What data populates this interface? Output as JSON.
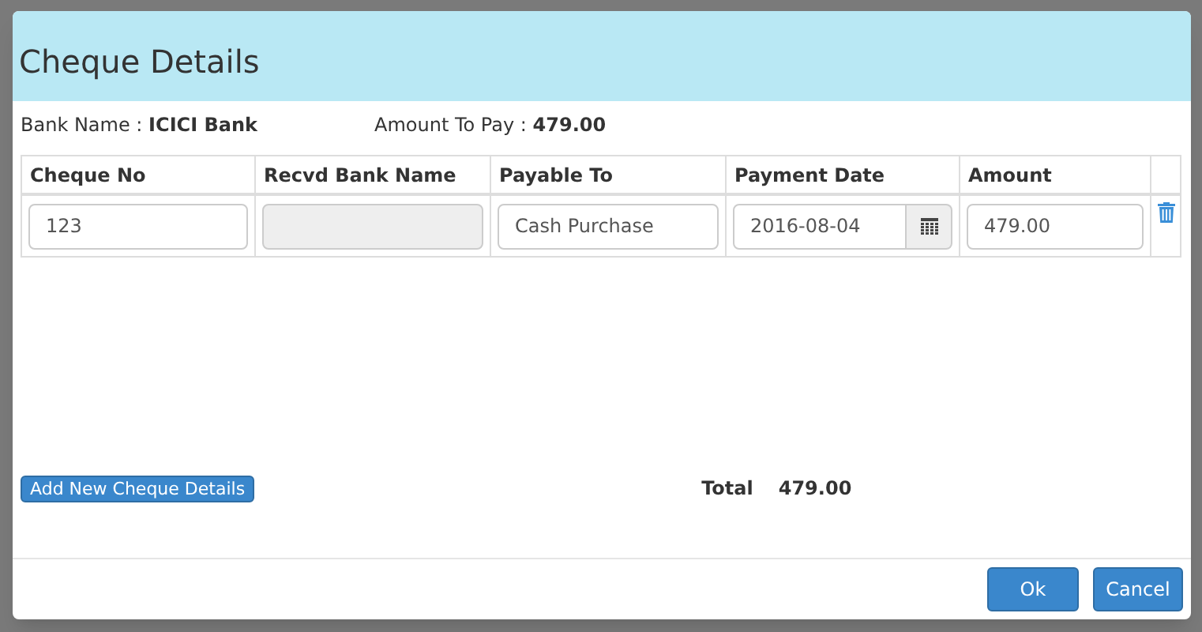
{
  "dialog": {
    "title": "Cheque Details",
    "info": [
      {
        "label": "Bank Name :",
        "value": "ICICI Bank"
      },
      {
        "label": "Amount To Pay :",
        "value": "479.00"
      }
    ],
    "table": {
      "columns": [
        "Cheque No",
        "Recvd Bank Name",
        "Payable To",
        "Payment Date",
        "Amount"
      ],
      "rows": [
        {
          "cheque_no": "123",
          "recvd_bank_name": "",
          "recvd_bank_disabled": true,
          "payable_to": "Cash Purchase",
          "payment_date": "2016-08-04",
          "amount": "479.00"
        }
      ]
    },
    "add_button": "Add New Cheque Details",
    "total": {
      "label": "Total",
      "value": "479.00"
    },
    "buttons": [
      "Ok",
      "Cancel"
    ]
  }
}
